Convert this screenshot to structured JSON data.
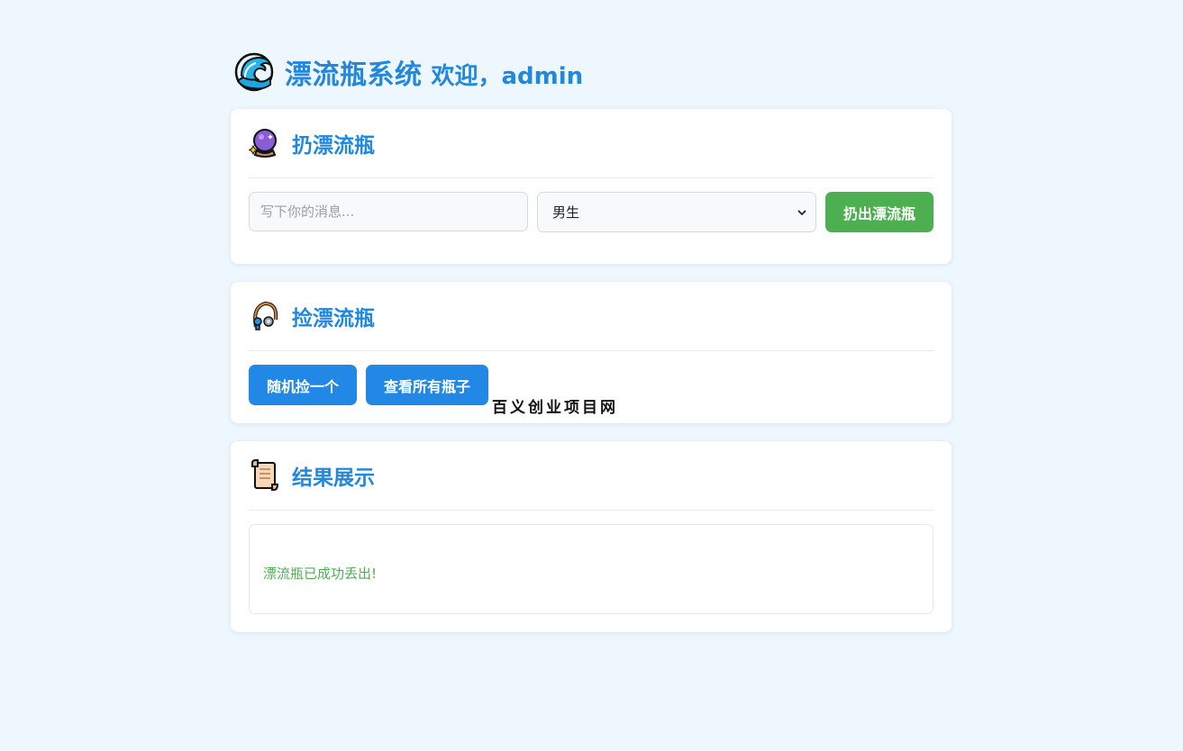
{
  "header": {
    "title": "漂流瓶系统",
    "welcome": "欢迎，admin"
  },
  "throw": {
    "title": "扔漂流瓶",
    "message_placeholder": "写下你的消息...",
    "message_value": "",
    "gender_selected": "男生",
    "submit_label": "扔出漂流瓶"
  },
  "pick": {
    "title": "捡漂流瓶",
    "random_label": "随机捡一个",
    "all_label": "查看所有瓶子",
    "watermark": "百义创业项目网"
  },
  "result": {
    "title": "结果展示",
    "message": "漂流瓶已成功丢出!"
  },
  "colors": {
    "accent": "#2188de",
    "success": "#4caf50",
    "background": "#eef6fe"
  },
  "icons": {
    "logo": "water-wave-icon",
    "throw": "crystal-ball-icon",
    "pick": "fishing-hook-icon",
    "result": "scroll-icon"
  }
}
